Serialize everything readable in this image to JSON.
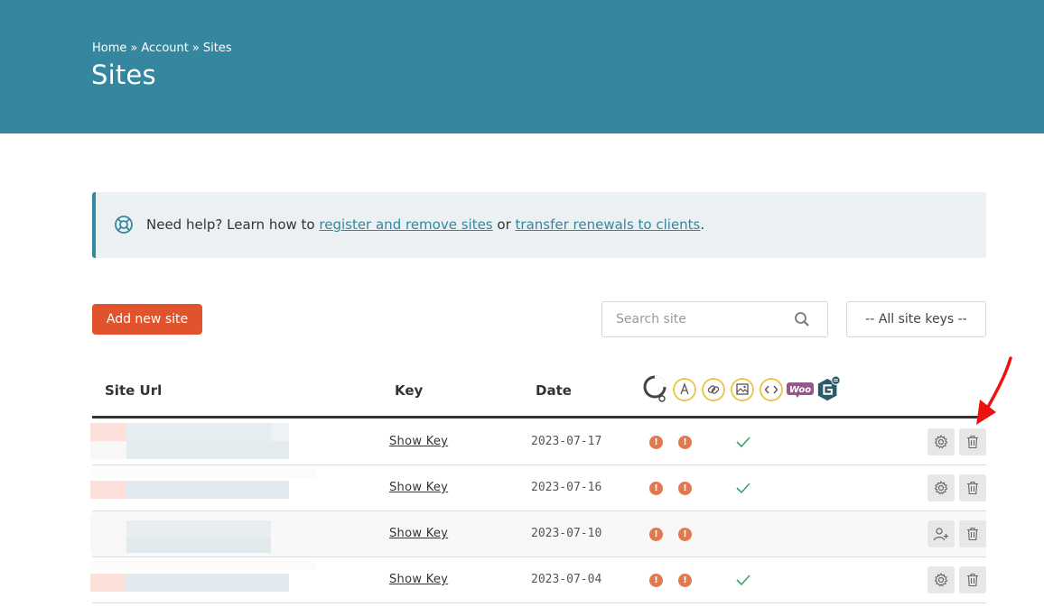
{
  "header": {
    "breadcrumb": [
      "Home",
      "Account",
      "Sites"
    ],
    "breadcrumb_separator": "»",
    "title": "Sites"
  },
  "notice": {
    "icon": "lifebuoy-icon",
    "text_before": "Need help? Learn how to ",
    "link1": "register and remove sites",
    "text_middle": " or ",
    "link2": "transfer renewals to clients",
    "text_after": "."
  },
  "toolbar": {
    "add_label": "Add new site",
    "search_placeholder": "Search site",
    "filter_value": "-- All site keys --"
  },
  "table": {
    "headers": {
      "url": "Site Url",
      "key": "Key",
      "date": "Date"
    },
    "service_icons": [
      "onboarding-icon",
      "speed-icon",
      "link-icon",
      "image-icon",
      "code-icon",
      "woocommerce-icon",
      "extra-service-icon"
    ],
    "rows": [
      {
        "key_label": "Show Key",
        "date": "2023-07-17",
        "status": [
          "!",
          "!"
        ],
        "checked": true,
        "action1": "settings",
        "action2": "delete"
      },
      {
        "key_label": "Show Key",
        "date": "2023-07-16",
        "status": [
          "!",
          "!"
        ],
        "checked": true,
        "action1": "settings",
        "action2": "delete"
      },
      {
        "key_label": "Show Key",
        "date": "2023-07-10",
        "status": [
          "!",
          "!"
        ],
        "checked": false,
        "action1": "add-user",
        "action2": "delete"
      },
      {
        "key_label": "Show Key",
        "date": "2023-07-04",
        "status": [
          "!",
          "!"
        ],
        "checked": true,
        "action1": "settings",
        "action2": "delete"
      }
    ]
  },
  "colors": {
    "header_bg": "#35879f",
    "accent": "#e0532d",
    "status_orange": "#e2784f",
    "check_green": "#3aa26b",
    "service_icon_yellow": "#f0c040",
    "woo_purple": "#96588a",
    "annotation_red": "#ee1111"
  }
}
